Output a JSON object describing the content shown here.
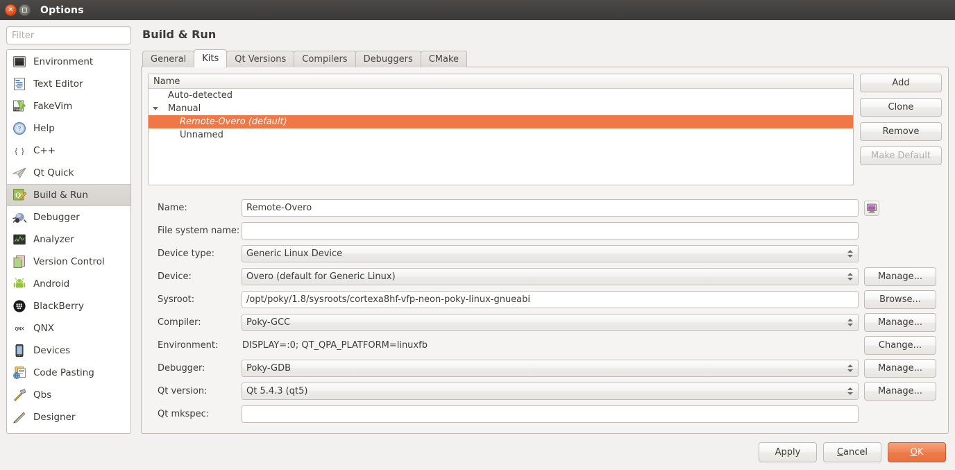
{
  "window": {
    "title": "Options",
    "close_icon": "close-icon",
    "maximize_icon": "maximize-icon"
  },
  "sidebar": {
    "filter": {
      "value": "",
      "placeholder": "Filter"
    },
    "items": [
      {
        "label": "Environment",
        "icon": "environment-icon",
        "selected": false
      },
      {
        "label": "Text Editor",
        "icon": "text-editor-icon",
        "selected": false
      },
      {
        "label": "FakeVim",
        "icon": "fakevim-icon",
        "selected": false
      },
      {
        "label": "Help",
        "icon": "help-icon",
        "selected": false
      },
      {
        "label": "C++",
        "icon": "cpp-icon",
        "selected": false
      },
      {
        "label": "Qt Quick",
        "icon": "qtquick-icon",
        "selected": false
      },
      {
        "label": "Build & Run",
        "icon": "build-run-icon",
        "selected": true
      },
      {
        "label": "Debugger",
        "icon": "debugger-icon",
        "selected": false
      },
      {
        "label": "Analyzer",
        "icon": "analyzer-icon",
        "selected": false
      },
      {
        "label": "Version Control",
        "icon": "version-control-icon",
        "selected": false
      },
      {
        "label": "Android",
        "icon": "android-icon",
        "selected": false
      },
      {
        "label": "BlackBerry",
        "icon": "blackberry-icon",
        "selected": false
      },
      {
        "label": "QNX",
        "icon": "qnx-icon",
        "selected": false
      },
      {
        "label": "Devices",
        "icon": "devices-icon",
        "selected": false
      },
      {
        "label": "Code Pasting",
        "icon": "code-pasting-icon",
        "selected": false
      },
      {
        "label": "Qbs",
        "icon": "qbs-icon",
        "selected": false
      },
      {
        "label": "Designer",
        "icon": "designer-icon",
        "selected": false
      }
    ]
  },
  "page": {
    "title": "Build & Run",
    "tabs": [
      {
        "label": "General",
        "active": false
      },
      {
        "label": "Kits",
        "active": true
      },
      {
        "label": "Qt Versions",
        "active": false
      },
      {
        "label": "Compilers",
        "active": false
      },
      {
        "label": "Debuggers",
        "active": false
      },
      {
        "label": "CMake",
        "active": false
      }
    ]
  },
  "kits": {
    "column_header": "Name",
    "rows": [
      {
        "label": "Auto-detected",
        "depth": 0,
        "expander": false,
        "selected": false
      },
      {
        "label": "Manual",
        "depth": 0,
        "expander": true,
        "selected": false
      },
      {
        "label": "Remote-Overo (default)",
        "depth": 1,
        "expander": false,
        "selected": true
      },
      {
        "label": "Unnamed",
        "depth": 1,
        "expander": false,
        "selected": false
      }
    ],
    "buttons": [
      {
        "label": "Add",
        "disabled": false
      },
      {
        "label": "Clone",
        "disabled": false
      },
      {
        "label": "Remove",
        "disabled": false
      },
      {
        "label": "Make Default",
        "disabled": true
      }
    ]
  },
  "form": {
    "name": {
      "label": "Name:",
      "value": "Remote-Overo",
      "icon_button": "monitor-icon"
    },
    "fs_name": {
      "label": "File system name:",
      "value": ""
    },
    "device_type": {
      "label": "Device type:",
      "value": "Generic Linux Device"
    },
    "device": {
      "label": "Device:",
      "value": "Overo (default for Generic Linux)",
      "button": "Manage..."
    },
    "sysroot": {
      "label": "Sysroot:",
      "value": "/opt/poky/1.8/sysroots/cortexa8hf-vfp-neon-poky-linux-gnueabi",
      "button": "Browse..."
    },
    "compiler": {
      "label": "Compiler:",
      "value": "Poky-GCC",
      "button": "Manage..."
    },
    "environment": {
      "label": "Environment:",
      "value": "DISPLAY=:0; QT_QPA_PLATFORM=linuxfb",
      "button": "Change..."
    },
    "debugger": {
      "label": "Debugger:",
      "value": "Poky-GDB",
      "button": "Manage..."
    },
    "qt_version": {
      "label": "Qt version:",
      "value": "Qt 5.4.3 (qt5)",
      "button": "Manage..."
    },
    "qt_mkspec": {
      "label": "Qt mkspec:",
      "value": ""
    }
  },
  "footer": {
    "apply": "Apply",
    "cancel": "Cancel",
    "ok": "OK"
  },
  "colors": {
    "selection_orange": "#f07746",
    "default_button_orange": "#ed7a4b",
    "titlebar": "#3c3b39"
  }
}
